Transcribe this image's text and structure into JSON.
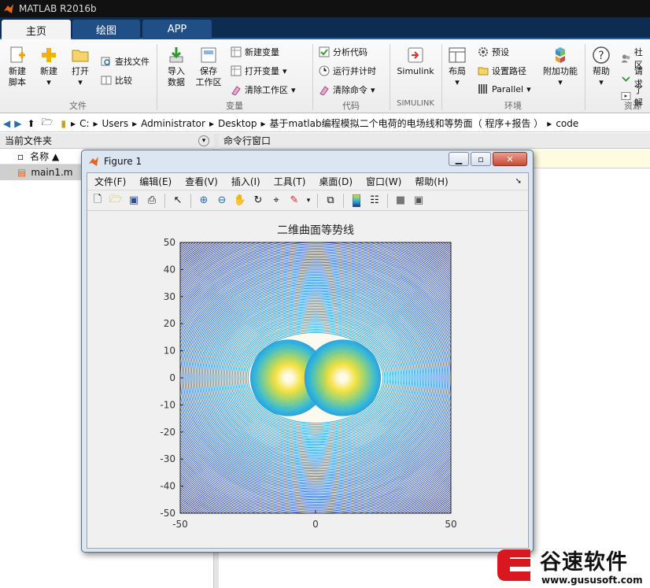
{
  "app": {
    "title": "MATLAB R2016b"
  },
  "tabs": [
    {
      "label": "主页"
    },
    {
      "label": "绘图"
    },
    {
      "label": "APP"
    }
  ],
  "ribbon": {
    "file": {
      "new_script": "新建\n脚本",
      "new": "新建",
      "open": "打开",
      "find_files": "查找文件",
      "compare": "比较",
      "section": "文件"
    },
    "variable": {
      "import": "导入\n数据",
      "save_ws": "保存\n工作区",
      "new_var": "新建变量",
      "open_var": "打开变量",
      "clear_ws": "清除工作区",
      "section": "变量"
    },
    "code": {
      "analyze": "分析代码",
      "run_time": "运行并计时",
      "clear_cmd": "清除命令",
      "section": "代码"
    },
    "simulink": {
      "label": "Simulink",
      "section": "SIMULINK"
    },
    "env": {
      "layout": "布局",
      "prefs": "预设",
      "set_path": "设置路径",
      "parallel": "Parallel",
      "addons": "附加功能",
      "section": "环境"
    },
    "resources": {
      "help": "帮助",
      "community": "社区",
      "request": "请求",
      "learn": "了解",
      "section": "资源"
    }
  },
  "address": {
    "crumbs": [
      "C:",
      "Users",
      "Administrator",
      "Desktop",
      "基于matlab编程模拟二个电荷的电场线和等势面（ 程序+报告 ）",
      "code"
    ]
  },
  "left_panel": {
    "title": "当前文件夹",
    "col_name": "名称 ▲",
    "files": [
      "main1.m"
    ]
  },
  "cmd_panel": {
    "title": "命令行窗口"
  },
  "figure": {
    "title": "Figure 1",
    "menus": [
      "文件(F)",
      "编辑(E)",
      "查看(V)",
      "插入(I)",
      "工具(T)",
      "桌面(D)",
      "窗口(W)",
      "帮助(H)"
    ]
  },
  "chart_data": {
    "type": "contour",
    "title": "二维曲面等势线",
    "xlabel": "",
    "ylabel": "",
    "xlim": [
      -50,
      50
    ],
    "ylim": [
      -50,
      50
    ],
    "xticks": [
      -50,
      0,
      50
    ],
    "yticks": [
      50,
      40,
      30,
      20,
      10,
      0,
      -10,
      -20,
      -30,
      -40,
      -50
    ],
    "charges": [
      {
        "x": -10,
        "y": 0
      },
      {
        "x": 10,
        "y": 0
      }
    ],
    "colormap": [
      "#1f2a8a",
      "#2a57c8",
      "#1f88e0",
      "#30b7d8",
      "#8dd07a",
      "#f2e03a",
      "#fffbe6"
    ],
    "background": "#fcfaee",
    "grid": false
  },
  "watermark": {
    "text": "谷速软件",
    "url": "www.gususoft.com"
  }
}
